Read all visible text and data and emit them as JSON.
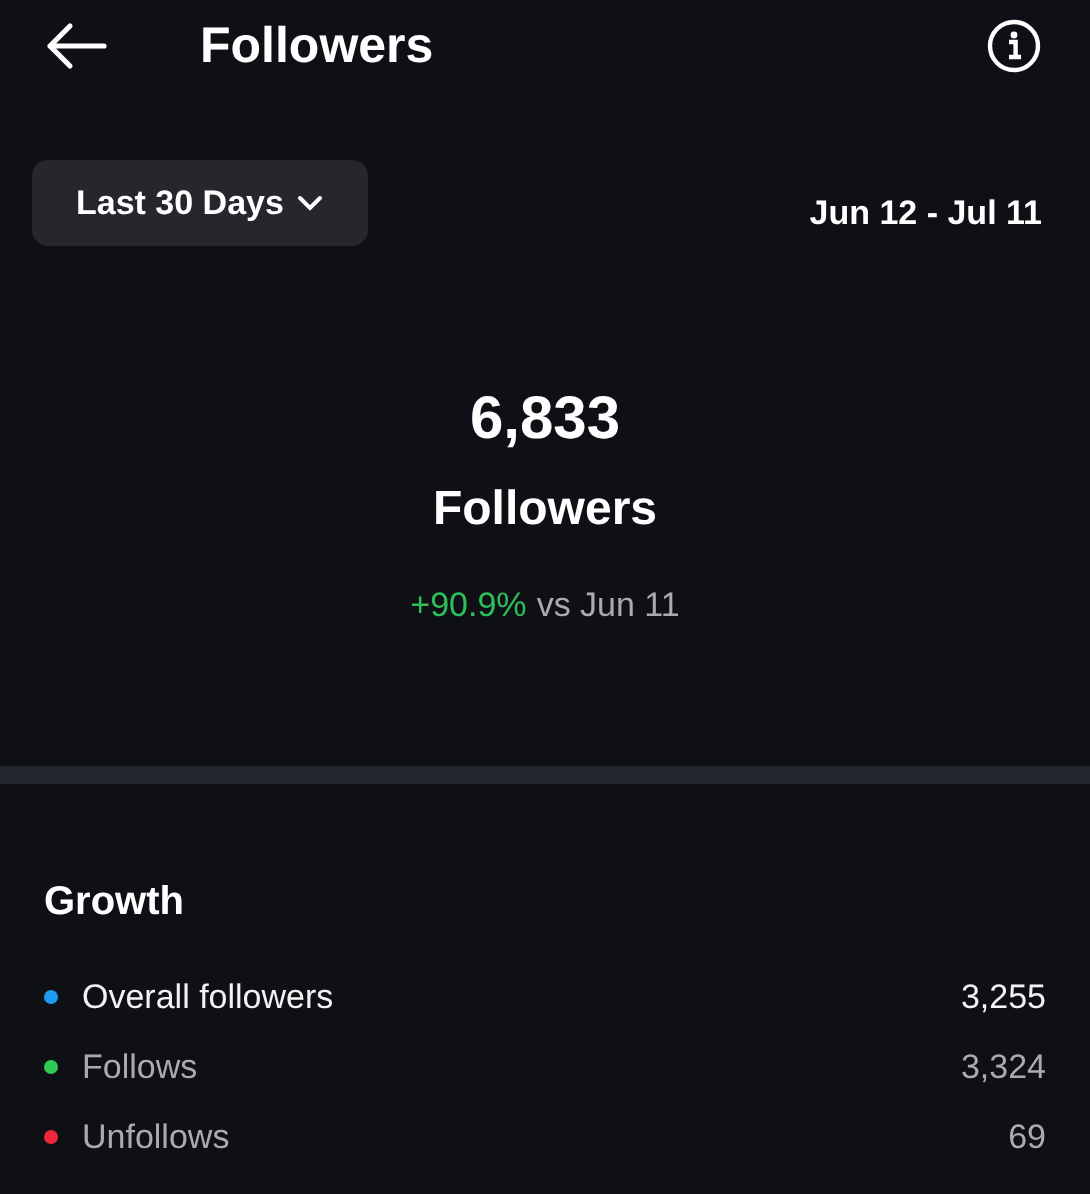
{
  "header": {
    "title": "Followers"
  },
  "period": {
    "label": "Last 30 Days",
    "range": "Jun 12 - Jul 11"
  },
  "summary": {
    "value": "6,833",
    "label": "Followers",
    "change": "+90.9%",
    "comparison": "vs Jun 11"
  },
  "growth": {
    "title": "Growth",
    "rows": [
      {
        "label": "Overall followers",
        "value": "3,255",
        "color": "#1d9bf0",
        "selected": true
      },
      {
        "label": "Follows",
        "value": "3,324",
        "color": "#2ecc55",
        "selected": false
      },
      {
        "label": "Unfollows",
        "value": "69",
        "color": "#f0283c",
        "selected": false
      }
    ]
  }
}
